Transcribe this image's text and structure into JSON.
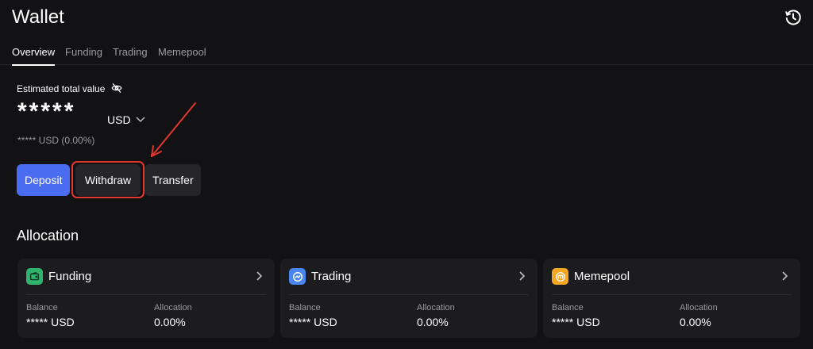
{
  "header": {
    "title": "Wallet",
    "history_icon": "history-clock-icon"
  },
  "tabs": [
    {
      "label": "Overview",
      "active": true
    },
    {
      "label": "Funding",
      "active": false
    },
    {
      "label": "Trading",
      "active": false
    },
    {
      "label": "Memepool",
      "active": false
    }
  ],
  "summary": {
    "label": "Estimated total value",
    "masked_value": "*****",
    "currency": "USD",
    "sub_value": "***** USD (0.00%)"
  },
  "actions": {
    "deposit": "Deposit",
    "withdraw": "Withdraw",
    "transfer": "Transfer"
  },
  "allocation": {
    "title": "Allocation",
    "cards": [
      {
        "name": "Funding",
        "icon": "wallet-icon",
        "icon_color": "#2fb36d",
        "balance_label": "Balance",
        "balance": "***** USD",
        "allocation_label": "Allocation",
        "allocation": "0.00%"
      },
      {
        "name": "Trading",
        "icon": "trend-chart-icon",
        "icon_color": "#4a86f0",
        "balance_label": "Balance",
        "balance": "***** USD",
        "allocation_label": "Allocation",
        "allocation": "0.00%"
      },
      {
        "name": "Memepool",
        "icon": "memepool-coin-icon",
        "icon_color": "#f5a623",
        "balance_label": "Balance",
        "balance": "***** USD",
        "allocation_label": "Allocation",
        "allocation": "0.00%"
      }
    ]
  },
  "colors": {
    "accent": "#4a6cf0",
    "highlight": "#e0382e",
    "background": "#121214",
    "card": "#1c1c1f"
  }
}
